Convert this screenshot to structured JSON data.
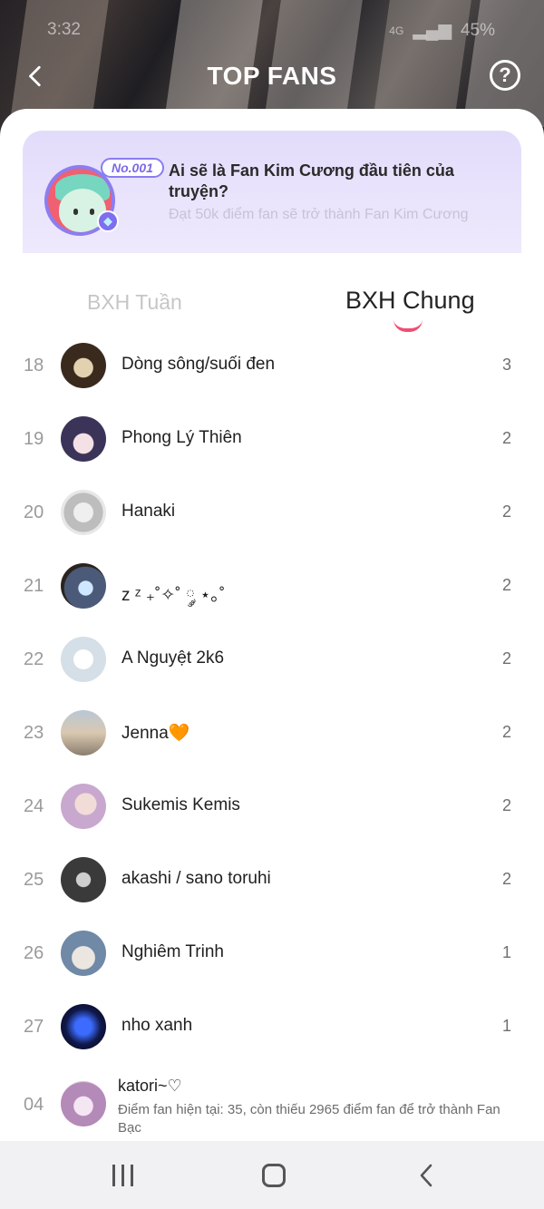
{
  "status_bar": {
    "time": "3:32",
    "network": "4G",
    "battery": "45%"
  },
  "header": {
    "title": "TOP FANS",
    "help_label": "?"
  },
  "banner": {
    "rank_tag": "No.001",
    "title": "Ai sẽ là Fan Kim Cương đầu tiên của truyện?",
    "subtitle": "Đạt 50k điểm fan sẽ trở thành Fan Kim Cương"
  },
  "tabs": [
    {
      "label": "BXH Tuần",
      "active": false
    },
    {
      "label": "BXH Chung",
      "active": true
    }
  ],
  "fans": [
    {
      "rank": "18",
      "name": "Dòng sông/suối đen",
      "score": "3"
    },
    {
      "rank": "19",
      "name": "Phong Lý Thiên",
      "score": "2"
    },
    {
      "rank": "20",
      "name": "Hanaki",
      "score": "2"
    },
    {
      "rank": "21",
      "name": "z ᶻ ₊˚✧˚ ༘ ⋆｡˚",
      "score": "2"
    },
    {
      "rank": "22",
      "name": "A Nguyệt 2k6",
      "score": "2"
    },
    {
      "rank": "23",
      "name": "Jenna🧡",
      "score": "2"
    },
    {
      "rank": "24",
      "name": "Sukemis Kemis",
      "score": "2"
    },
    {
      "rank": "25",
      "name": "akashi / sano toruhi",
      "score": "2"
    },
    {
      "rank": "26",
      "name": "Nghiêm Trinh",
      "score": "1"
    },
    {
      "rank": "27",
      "name": "nho xanh",
      "score": "1"
    }
  ],
  "me": {
    "rank": "04",
    "name": "katori~♡",
    "description": "Điểm fan hiện tại: 35, còn thiếu 2965 điểm fan để trở thành Fan Bạc"
  }
}
